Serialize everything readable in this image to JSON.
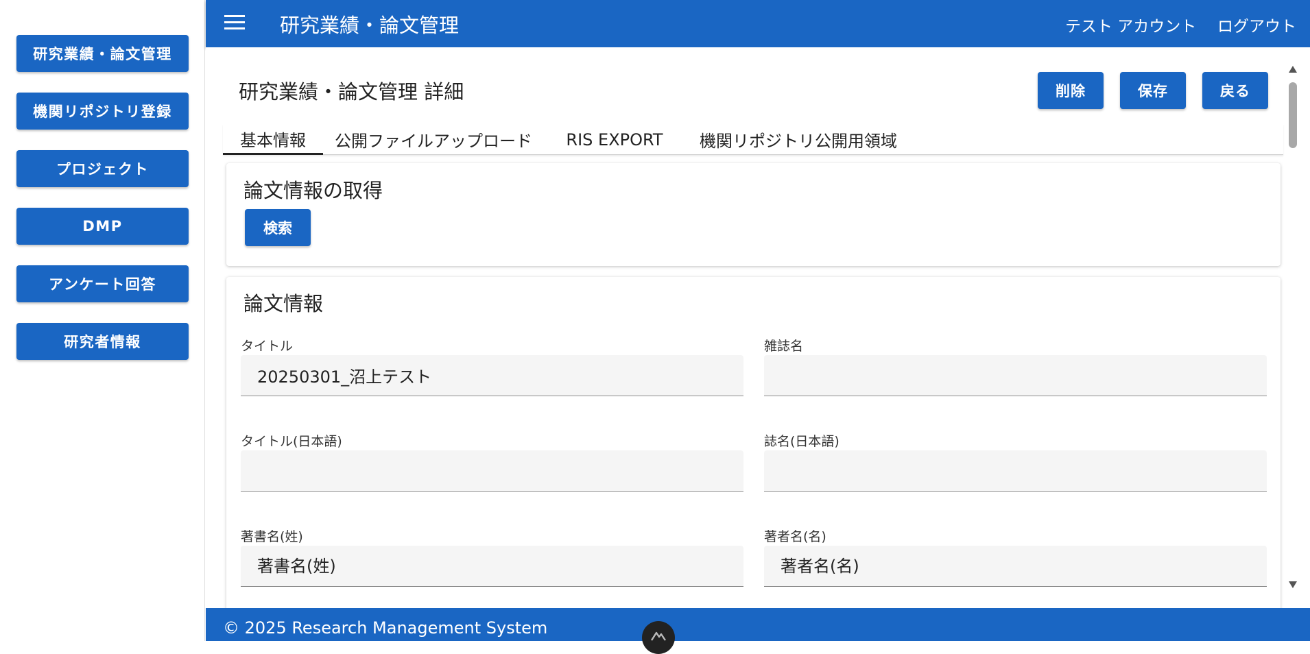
{
  "sidebar": {
    "items": [
      {
        "label": "研究業績・論文管理"
      },
      {
        "label": "機関リポジトリ登録"
      },
      {
        "label": "プロジェクト"
      },
      {
        "label": "DMP"
      },
      {
        "label": "アンケート回答"
      },
      {
        "label": "研究者情報"
      }
    ]
  },
  "appbar": {
    "title": "研究業績・論文管理",
    "user": "テスト アカウント",
    "logout": "ログアウト"
  },
  "page": {
    "title": "研究業績・論文管理 詳細",
    "delete": "削除",
    "save": "保存",
    "back": "戻る"
  },
  "tabs": [
    {
      "label": "基本情報",
      "active": true
    },
    {
      "label": "公開ファイルアップロード",
      "active": false
    },
    {
      "label": "RIS EXPORT",
      "active": false
    },
    {
      "label": "機関リポジトリ公開用領域",
      "active": false
    }
  ],
  "fetch_card": {
    "title": "論文情報の取得",
    "search": "検索"
  },
  "info_card": {
    "title": "論文情報",
    "fields": {
      "title": {
        "label": "タイトル",
        "value": "20250301_沼上テスト"
      },
      "journal": {
        "label": "雑誌名",
        "value": ""
      },
      "title_ja": {
        "label": "タイトル(日本語)",
        "value": ""
      },
      "journal_ja": {
        "label": "誌名(日本語)",
        "value": ""
      },
      "author_last": {
        "label": "著書名(姓)",
        "placeholder": "著書名(姓)"
      },
      "author_first": {
        "label": "著者名(名)",
        "placeholder": "著者名(名)"
      }
    }
  },
  "footer": {
    "text": "© 2025 Research Management System"
  },
  "icons": {
    "menu": "hamburger-menu-icon",
    "logo": "mountain-logo-icon"
  },
  "colors": {
    "primary": "#1a66c3",
    "background": "#ffffff",
    "input_bg": "#f5f5f5"
  }
}
